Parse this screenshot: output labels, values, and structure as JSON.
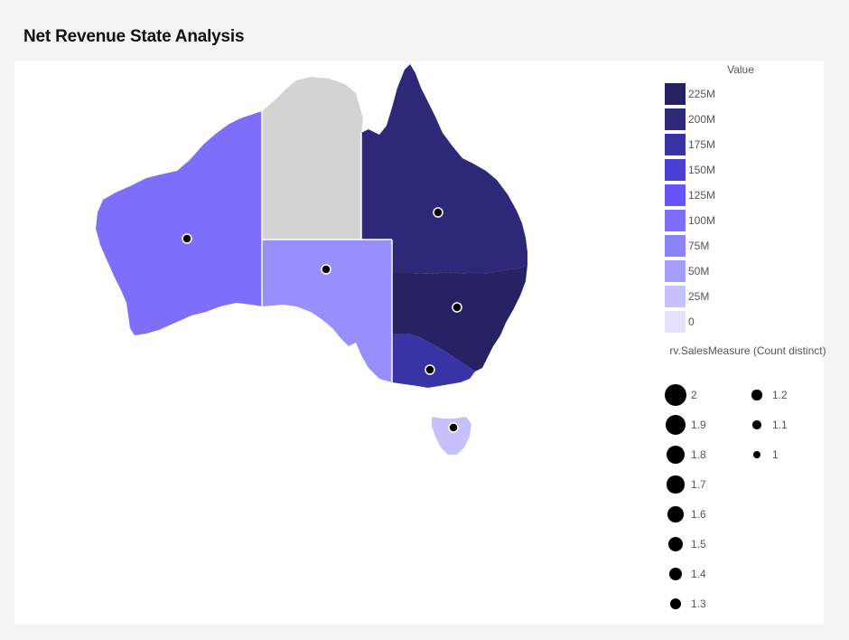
{
  "title": "Net Revenue State Analysis",
  "color_legend": {
    "title": "Value",
    "items": [
      {
        "label": "225M",
        "color": "#272263"
      },
      {
        "label": "200M",
        "color": "#2e2878"
      },
      {
        "label": "175M",
        "color": "#3a33a6"
      },
      {
        "label": "150M",
        "color": "#4a3fd2"
      },
      {
        "label": "125M",
        "color": "#6654f6"
      },
      {
        "label": "100M",
        "color": "#7d6ff9"
      },
      {
        "label": "75M",
        "color": "#8c82fa"
      },
      {
        "label": "50M",
        "color": "#a39dfb"
      },
      {
        "label": "25M",
        "color": "#c6c1fc"
      },
      {
        "label": "0",
        "color": "#e6e3fe"
      }
    ]
  },
  "size_legend": {
    "title": "rv.SalesMeasure (Count distinct)",
    "items": [
      {
        "label": "2",
        "value": 2.0
      },
      {
        "label": "1.9",
        "value": 1.9
      },
      {
        "label": "1.8",
        "value": 1.8
      },
      {
        "label": "1.7",
        "value": 1.7
      },
      {
        "label": "1.6",
        "value": 1.6
      },
      {
        "label": "1.5",
        "value": 1.5
      },
      {
        "label": "1.4",
        "value": 1.4
      },
      {
        "label": "1.3",
        "value": 1.3
      },
      {
        "label": "1.2",
        "value": 1.2
      },
      {
        "label": "1.1",
        "value": 1.1
      },
      {
        "label": "1",
        "value": 1.0
      }
    ]
  },
  "map_regions": {
    "wa": {
      "fill": "#7d6ff9"
    },
    "nt": {
      "fill": "#d3d3d3"
    },
    "qld": {
      "fill": "#2e2878"
    },
    "sa": {
      "fill": "#978ffb"
    },
    "nsw": {
      "fill": "#272263"
    },
    "vic": {
      "fill": "#3a33a6"
    },
    "tas": {
      "fill": "#c6c1fc"
    }
  }
}
